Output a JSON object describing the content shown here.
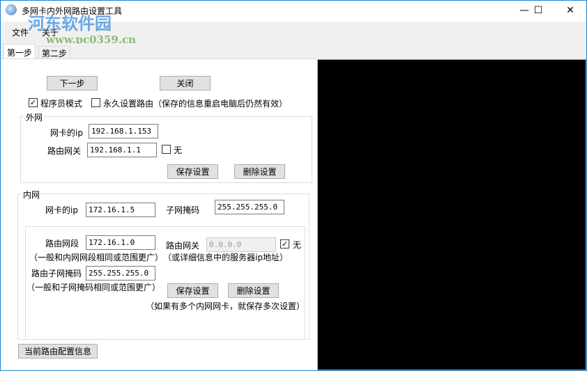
{
  "window": {
    "title": "多网卡内外网路由设置工具",
    "minimize": "—",
    "maximize": "☐",
    "close": "✕"
  },
  "watermark": {
    "name": "河东软件园",
    "url": "www.pc0359.cn"
  },
  "menu": [
    "文件",
    "关于"
  ],
  "tabs": [
    "第一步",
    "第二步"
  ],
  "top": {
    "next": "下一步",
    "close": "关闭",
    "programmer_mode": "程序员模式",
    "programmer_checked": true,
    "permanent": "永久设置路由（保存的信息重启电脑后仍然有效）",
    "permanent_checked": false
  },
  "wan": {
    "title": "外网",
    "nic_ip_label": "网卡的ip",
    "nic_ip": "192.168.1.153",
    "gateway_label": "路由网关",
    "gateway": "192.168.1.1",
    "none_label": "无",
    "none_checked": false,
    "save": "保存设置",
    "delete": "删除设置"
  },
  "lan": {
    "title": "内网",
    "nic_ip_label": "网卡的ip",
    "nic_ip": "172.16.1.5",
    "mask_label": "子网掩码",
    "mask": "255.255.255.0",
    "segment_label": "路由网段",
    "segment": "172.16.1.0",
    "segment_hint": "（一般和内网网段相同或范围更广）",
    "gateway_label": "路由网关",
    "gateway": "0.0.0.0",
    "none_label": "无",
    "none_checked": true,
    "gateway_hint": "（或详细信息中的服务器ip地址）",
    "route_mask_label": "路由子网掩码",
    "route_mask": "255.255.255.0",
    "route_mask_hint": "（一般和子网掩码相同或范围更广）",
    "save": "保存设置",
    "delete": "删除设置",
    "multi_hint": "（如果有多个内网网卡，就保存多次设置）"
  },
  "current_config": "当前路由配置信息"
}
